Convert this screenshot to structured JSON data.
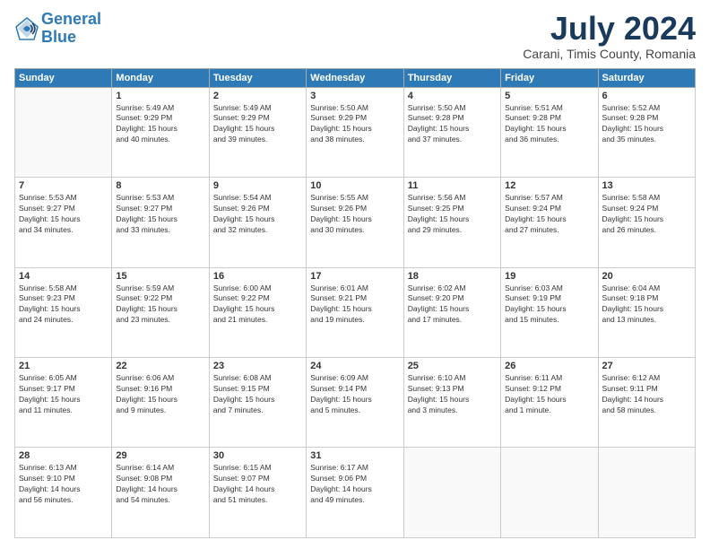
{
  "header": {
    "logo_line1": "General",
    "logo_line2": "Blue",
    "month": "July 2024",
    "location": "Carani, Timis County, Romania"
  },
  "weekdays": [
    "Sunday",
    "Monday",
    "Tuesday",
    "Wednesday",
    "Thursday",
    "Friday",
    "Saturday"
  ],
  "weeks": [
    [
      {
        "day": "",
        "info": ""
      },
      {
        "day": "1",
        "info": "Sunrise: 5:49 AM\nSunset: 9:29 PM\nDaylight: 15 hours\nand 40 minutes."
      },
      {
        "day": "2",
        "info": "Sunrise: 5:49 AM\nSunset: 9:29 PM\nDaylight: 15 hours\nand 39 minutes."
      },
      {
        "day": "3",
        "info": "Sunrise: 5:50 AM\nSunset: 9:29 PM\nDaylight: 15 hours\nand 38 minutes."
      },
      {
        "day": "4",
        "info": "Sunrise: 5:50 AM\nSunset: 9:28 PM\nDaylight: 15 hours\nand 37 minutes."
      },
      {
        "day": "5",
        "info": "Sunrise: 5:51 AM\nSunset: 9:28 PM\nDaylight: 15 hours\nand 36 minutes."
      },
      {
        "day": "6",
        "info": "Sunrise: 5:52 AM\nSunset: 9:28 PM\nDaylight: 15 hours\nand 35 minutes."
      }
    ],
    [
      {
        "day": "7",
        "info": "Sunrise: 5:53 AM\nSunset: 9:27 PM\nDaylight: 15 hours\nand 34 minutes."
      },
      {
        "day": "8",
        "info": "Sunrise: 5:53 AM\nSunset: 9:27 PM\nDaylight: 15 hours\nand 33 minutes."
      },
      {
        "day": "9",
        "info": "Sunrise: 5:54 AM\nSunset: 9:26 PM\nDaylight: 15 hours\nand 32 minutes."
      },
      {
        "day": "10",
        "info": "Sunrise: 5:55 AM\nSunset: 9:26 PM\nDaylight: 15 hours\nand 30 minutes."
      },
      {
        "day": "11",
        "info": "Sunrise: 5:56 AM\nSunset: 9:25 PM\nDaylight: 15 hours\nand 29 minutes."
      },
      {
        "day": "12",
        "info": "Sunrise: 5:57 AM\nSunset: 9:24 PM\nDaylight: 15 hours\nand 27 minutes."
      },
      {
        "day": "13",
        "info": "Sunrise: 5:58 AM\nSunset: 9:24 PM\nDaylight: 15 hours\nand 26 minutes."
      }
    ],
    [
      {
        "day": "14",
        "info": "Sunrise: 5:58 AM\nSunset: 9:23 PM\nDaylight: 15 hours\nand 24 minutes."
      },
      {
        "day": "15",
        "info": "Sunrise: 5:59 AM\nSunset: 9:22 PM\nDaylight: 15 hours\nand 23 minutes."
      },
      {
        "day": "16",
        "info": "Sunrise: 6:00 AM\nSunset: 9:22 PM\nDaylight: 15 hours\nand 21 minutes."
      },
      {
        "day": "17",
        "info": "Sunrise: 6:01 AM\nSunset: 9:21 PM\nDaylight: 15 hours\nand 19 minutes."
      },
      {
        "day": "18",
        "info": "Sunrise: 6:02 AM\nSunset: 9:20 PM\nDaylight: 15 hours\nand 17 minutes."
      },
      {
        "day": "19",
        "info": "Sunrise: 6:03 AM\nSunset: 9:19 PM\nDaylight: 15 hours\nand 15 minutes."
      },
      {
        "day": "20",
        "info": "Sunrise: 6:04 AM\nSunset: 9:18 PM\nDaylight: 15 hours\nand 13 minutes."
      }
    ],
    [
      {
        "day": "21",
        "info": "Sunrise: 6:05 AM\nSunset: 9:17 PM\nDaylight: 15 hours\nand 11 minutes."
      },
      {
        "day": "22",
        "info": "Sunrise: 6:06 AM\nSunset: 9:16 PM\nDaylight: 15 hours\nand 9 minutes."
      },
      {
        "day": "23",
        "info": "Sunrise: 6:08 AM\nSunset: 9:15 PM\nDaylight: 15 hours\nand 7 minutes."
      },
      {
        "day": "24",
        "info": "Sunrise: 6:09 AM\nSunset: 9:14 PM\nDaylight: 15 hours\nand 5 minutes."
      },
      {
        "day": "25",
        "info": "Sunrise: 6:10 AM\nSunset: 9:13 PM\nDaylight: 15 hours\nand 3 minutes."
      },
      {
        "day": "26",
        "info": "Sunrise: 6:11 AM\nSunset: 9:12 PM\nDaylight: 15 hours\nand 1 minute."
      },
      {
        "day": "27",
        "info": "Sunrise: 6:12 AM\nSunset: 9:11 PM\nDaylight: 14 hours\nand 58 minutes."
      }
    ],
    [
      {
        "day": "28",
        "info": "Sunrise: 6:13 AM\nSunset: 9:10 PM\nDaylight: 14 hours\nand 56 minutes."
      },
      {
        "day": "29",
        "info": "Sunrise: 6:14 AM\nSunset: 9:08 PM\nDaylight: 14 hours\nand 54 minutes."
      },
      {
        "day": "30",
        "info": "Sunrise: 6:15 AM\nSunset: 9:07 PM\nDaylight: 14 hours\nand 51 minutes."
      },
      {
        "day": "31",
        "info": "Sunrise: 6:17 AM\nSunset: 9:06 PM\nDaylight: 14 hours\nand 49 minutes."
      },
      {
        "day": "",
        "info": ""
      },
      {
        "day": "",
        "info": ""
      },
      {
        "day": "",
        "info": ""
      }
    ]
  ]
}
